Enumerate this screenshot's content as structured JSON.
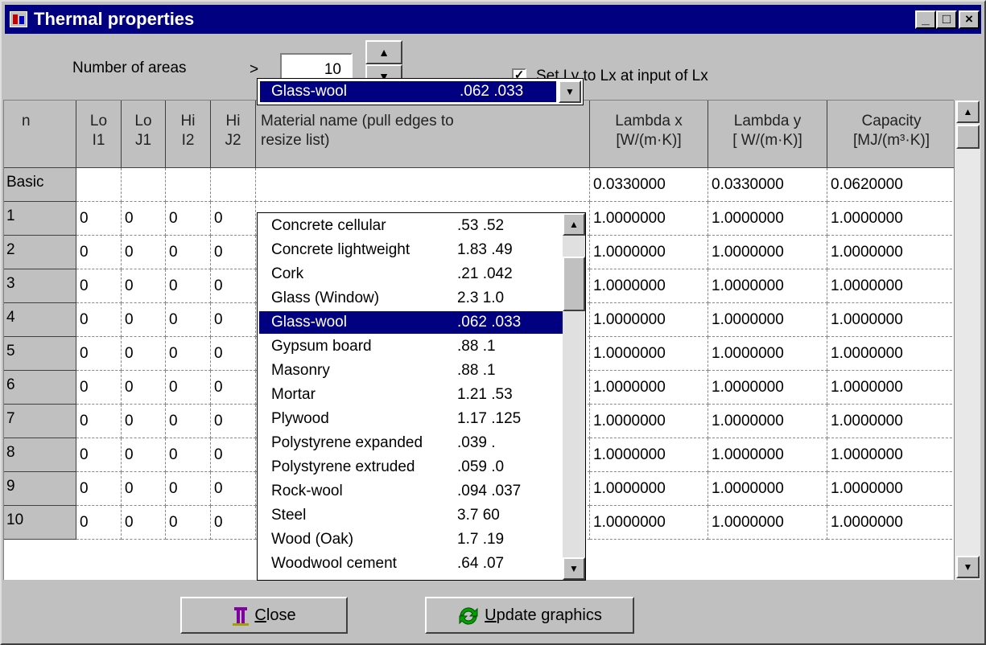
{
  "window": {
    "title": "Thermal properties",
    "controls": {
      "minimize": "_",
      "maximize": "□",
      "close": "×"
    }
  },
  "areas": {
    "label": "Number of areas",
    "arrow": ">",
    "value": "10"
  },
  "set_ly": {
    "checked": true,
    "label": "Set Ly to Lx at input of Lx"
  },
  "table": {
    "headers": {
      "n": "n",
      "lo_i1": [
        "Lo",
        "I1"
      ],
      "lo_j1": [
        "Lo",
        "J1"
      ],
      "hi_i2": [
        "Hi",
        "I2"
      ],
      "hi_j2": [
        "Hi",
        "J2"
      ],
      "material": [
        "Material name (pull edges to",
        "resize list)"
      ],
      "lambda_x": [
        "Lambda x",
        "[W/(m·K)]"
      ],
      "lambda_y": [
        "Lambda y",
        "[ W/(m·K)]"
      ],
      "capacity": [
        "Capacity",
        "[MJ/(m³·K)]"
      ]
    },
    "rows": [
      {
        "n": "Basic",
        "lo_i1": "",
        "lo_j1": "",
        "hi_i2": "",
        "hi_j2": "",
        "lambda_x": "0.0330000",
        "lambda_y": "0.0330000",
        "capacity": "0.0620000"
      },
      {
        "n": "1",
        "lo_i1": "0",
        "lo_j1": "0",
        "hi_i2": "0",
        "hi_j2": "0",
        "lambda_x": "1.0000000",
        "lambda_y": "1.0000000",
        "capacity": "1.0000000"
      },
      {
        "n": "2",
        "lo_i1": "0",
        "lo_j1": "0",
        "hi_i2": "0",
        "hi_j2": "0",
        "lambda_x": "1.0000000",
        "lambda_y": "1.0000000",
        "capacity": "1.0000000"
      },
      {
        "n": "3",
        "lo_i1": "0",
        "lo_j1": "0",
        "hi_i2": "0",
        "hi_j2": "0",
        "lambda_x": "1.0000000",
        "lambda_y": "1.0000000",
        "capacity": "1.0000000"
      },
      {
        "n": "4",
        "lo_i1": "0",
        "lo_j1": "0",
        "hi_i2": "0",
        "hi_j2": "0",
        "lambda_x": "1.0000000",
        "lambda_y": "1.0000000",
        "capacity": "1.0000000"
      },
      {
        "n": "5",
        "lo_i1": "0",
        "lo_j1": "0",
        "hi_i2": "0",
        "hi_j2": "0",
        "lambda_x": "1.0000000",
        "lambda_y": "1.0000000",
        "capacity": "1.0000000"
      },
      {
        "n": "6",
        "lo_i1": "0",
        "lo_j1": "0",
        "hi_i2": "0",
        "hi_j2": "0",
        "lambda_x": "1.0000000",
        "lambda_y": "1.0000000",
        "capacity": "1.0000000"
      },
      {
        "n": "7",
        "lo_i1": "0",
        "lo_j1": "0",
        "hi_i2": "0",
        "hi_j2": "0",
        "lambda_x": "1.0000000",
        "lambda_y": "1.0000000",
        "capacity": "1.0000000"
      },
      {
        "n": "8",
        "lo_i1": "0",
        "lo_j1": "0",
        "hi_i2": "0",
        "hi_j2": "0",
        "lambda_x": "1.0000000",
        "lambda_y": "1.0000000",
        "capacity": "1.0000000"
      },
      {
        "n": "9",
        "lo_i1": "0",
        "lo_j1": "0",
        "hi_i2": "0",
        "hi_j2": "0",
        "lambda_x": "1.0000000",
        "lambda_y": "1.0000000",
        "capacity": "1.0000000"
      },
      {
        "n": "10",
        "lo_i1": "0",
        "lo_j1": "0",
        "hi_i2": "0",
        "hi_j2": "0",
        "lambda_x": "1.0000000",
        "lambda_y": "1.0000000",
        "capacity": "1.0000000"
      }
    ]
  },
  "material_combo": {
    "selected_name": "Glass-wool",
    "selected_values": ".062 .033"
  },
  "material_list": [
    {
      "name": "Concrete cellular",
      "values": ".53 .52",
      "selected": false
    },
    {
      "name": "Concrete lightweight",
      "values": "1.83 .49",
      "selected": false
    },
    {
      "name": "Cork",
      "values": ".21 .042",
      "selected": false
    },
    {
      "name": "Glass (Window)",
      "values": "2.3 1.0",
      "selected": false
    },
    {
      "name": "Glass-wool",
      "values": ".062 .033",
      "selected": true
    },
    {
      "name": "Gypsum board",
      "values": ".88 .1",
      "selected": false
    },
    {
      "name": "Masonry",
      "values": ".88 .1",
      "selected": false
    },
    {
      "name": "Mortar",
      "values": "1.21 .53",
      "selected": false
    },
    {
      "name": "Plywood",
      "values": "1.17 .125",
      "selected": false
    },
    {
      "name": "Polystyrene expanded",
      "values": ".039 .",
      "selected": false
    },
    {
      "name": "Polystyrene extruded",
      "values": ".059 .0",
      "selected": false
    },
    {
      "name": "Rock-wool",
      "values": ".094 .037",
      "selected": false
    },
    {
      "name": "Steel",
      "values": "3.7 60",
      "selected": false
    },
    {
      "name": "Wood (Oak)",
      "values": "1.7 .19",
      "selected": false
    },
    {
      "name": "Woodwool cement",
      "values": ".64 .07",
      "selected": false
    }
  ],
  "buttons": {
    "close_mnemonic": "C",
    "close_rest": "lose",
    "update_mnemonic": "U",
    "update_rest": "pdate graphics"
  },
  "icons": {
    "window": "app-icon",
    "close": "person-exit-icon",
    "update": "refresh-arrows-icon",
    "scroll_up": "scroll-up-arrow-icon",
    "scroll_down": "scroll-down-arrow-icon"
  },
  "colors": {
    "titlebar": "#000080",
    "face": "#c0c0c0",
    "selection": "#000080",
    "refresh_icon": "#00a000"
  }
}
